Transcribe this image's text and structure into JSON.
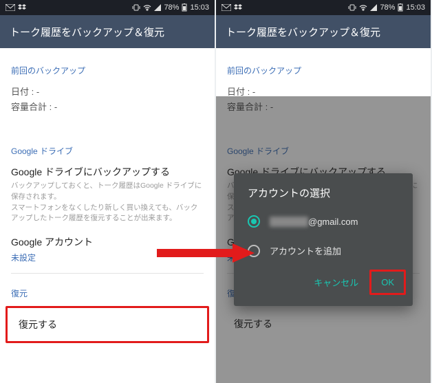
{
  "status": {
    "battery_pct": "78%",
    "time": "15:03"
  },
  "header": {
    "title": "トーク履歴をバックアップ＆復元"
  },
  "sec_backup": {
    "label": "前回のバックアップ",
    "date_label": "日付",
    "date_value": "-",
    "size_label": "容量合計",
    "size_value": "-"
  },
  "sec_drive": {
    "label": "Google ドライブ",
    "backup_title": "Google ドライブにバックアップする",
    "backup_desc1": "バックアップしておくと、トーク履歴はGoogle ドライブに保存されます。",
    "backup_desc2": "スマートフォンをなくしたり新しく買い換えても、バックアップしたトーク履歴を復元することが出来ます。",
    "account_label": "Google アカウント",
    "account_value": "未設定"
  },
  "sec_restore": {
    "label": "復元",
    "button": "復元する"
  },
  "dialog": {
    "title": "アカウントの選択",
    "account_domain": "@gmail.com",
    "add_account": "アカウントを追加",
    "cancel": "キャンセル",
    "ok": "OK"
  }
}
